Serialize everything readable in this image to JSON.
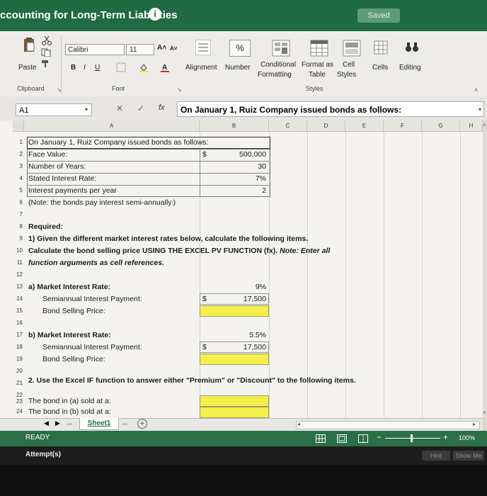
{
  "title_bar": {
    "title": "ccounting for Long-Term Liabilities",
    "info_icon": "i",
    "saved_label": "Saved"
  },
  "ribbon": {
    "paste_label": "Paste",
    "clipboard_label": "Clipboard",
    "font_name": "Calibri",
    "font_size": "11",
    "grow_font": "A˄",
    "shrink_font": "A˅",
    "bold": "B",
    "italic": "I",
    "underline": "U",
    "font_group_label": "Font",
    "alignment_label": "Alignment",
    "number_label": "Number",
    "percent_symbol": "%",
    "conditional_formatting_label_1": "Conditional",
    "conditional_formatting_label_2": "Formatting",
    "format_as_table_label_1": "Format as",
    "format_as_table_label_2": "Table",
    "cell_styles_label_1": "Cell",
    "cell_styles_label_2": "Styles",
    "styles_group_label": "Styles",
    "cells_label": "Cells",
    "editing_label": "Editing"
  },
  "formula_bar": {
    "name_box": "A1",
    "fx": "fx",
    "content": "On January 1, Ruiz Company issued bonds as follows:"
  },
  "columns": [
    "A",
    "B",
    "C",
    "D",
    "E",
    "F",
    "G",
    "H"
  ],
  "rows": [
    "1",
    "2",
    "3",
    "4",
    "5",
    "6",
    "7",
    "8",
    "9",
    "10",
    "11",
    "12",
    "13",
    "14",
    "15",
    "16",
    "17",
    "18",
    "19",
    "20",
    "21",
    "22",
    "23",
    "24"
  ],
  "sheet": {
    "r1": "On January 1, Ruiz Company issued bonds as follows:",
    "r2_label": "Face Value:",
    "r2_dollar": "$",
    "r2_value": "500,000",
    "r3_label": "Number of Years:",
    "r3_value": "30",
    "r4_label": "Stated Interest Rate:",
    "r4_value": "7%",
    "r5_label": "Interest payments per year",
    "r5_value": "2",
    "r6": "(Note: the bonds pay interest semi-annually.)",
    "r8": "Required:",
    "r9": "1) Given the different market interest rates below, calculate the following items.",
    "r10_a": "Calculate the bond selling price USING THE EXCEL PV FUNCTION (fx).",
    "r10_b": "Note: Enter all",
    "r11": "function arguments as cell references.",
    "r13_label": "a)  Market Interest Rate:",
    "r13_value": "9%",
    "r14_label": "Semiannual Interest Payment:",
    "r14_dollar": "$",
    "r14_value": "17,500",
    "r15_label": "Bond Selling Price:",
    "r17_label": "b)  Market Interest Rate:",
    "r17_value": "5.5%",
    "r18_label": "Semiannual Interest Payment:",
    "r18_dollar": "$",
    "r18_value": "17,500",
    "r19_label": "Bond Selling Price:",
    "r21": "2. Use the Excel IF function to answer either \"Premium\" or \"Discount\" to the following items.",
    "r23_label": "The bond in (a) sold at a:",
    "r24_label": "The bond in (b) sold at a:"
  },
  "tabs": {
    "ellipsis": "...",
    "sheet1": "Sheet1",
    "ellipsis2": "..."
  },
  "status": {
    "ready": "READY",
    "zoom": "100%"
  },
  "footer": {
    "attempts": "Attempt(s)",
    "hint": "Hint",
    "show_me": "Show Me"
  },
  "colors": {
    "title_green": "#1f6b42",
    "input_yellow": "#f5ef4a"
  }
}
